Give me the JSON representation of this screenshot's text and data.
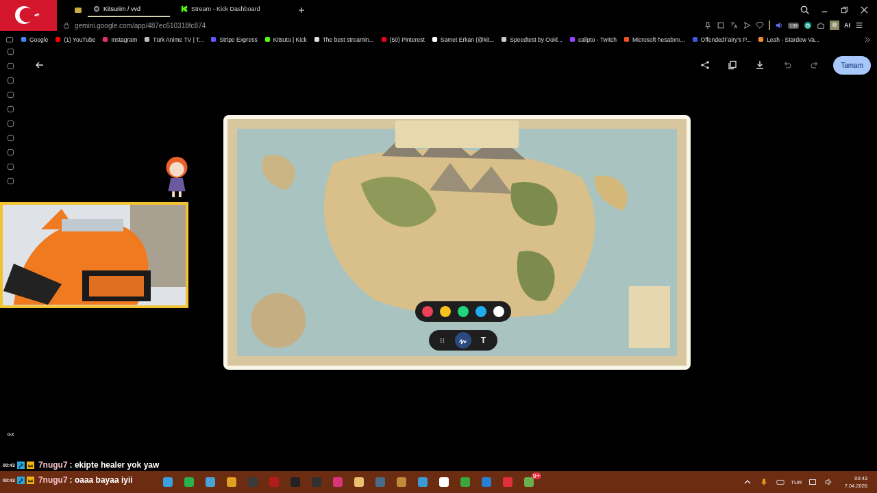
{
  "browser": {
    "tabs": [
      {
        "title": "Kitsurim / vvd",
        "selected": true
      },
      {
        "title": "Stream - Kick Dashboard",
        "selected": false
      }
    ],
    "url": "gemini.google.com/app/487ec610318fc874",
    "bookmarks": [
      "Google",
      "(1) YouTube",
      "Instagram",
      "Türk Anime TV | T...",
      "Stripe Express",
      "Kitsuto | Kick",
      "The best streamin...",
      "(50) Pinterest",
      "Samet Erkan (@kit...",
      "Speedtest by Ookl...",
      "calipto - Twitch",
      "Microsoft hesabını...",
      "OffendedFairy's P...",
      "Leah - Stardew Va..."
    ],
    "extension_badge": "139",
    "ai_label": "AI"
  },
  "sidebar": {
    "label": "GX"
  },
  "editor": {
    "done_button": "Tamam",
    "palette": [
      {
        "color": "#ee4058",
        "selected": false
      },
      {
        "color": "#f7c21a",
        "selected": false
      },
      {
        "color": "#1fd67a",
        "selected": false
      },
      {
        "color": "#1eaef0",
        "selected": false
      },
      {
        "color": "#ffffff",
        "selected": false
      }
    ],
    "tools": [
      {
        "kind": "handle",
        "selected": false
      },
      {
        "kind": "pen",
        "selected": true
      },
      {
        "kind": "text",
        "label": "T",
        "selected": false
      }
    ]
  },
  "chat": [
    {
      "time": "00:43",
      "user": "7nugu7",
      "message": ": ekipte healer yok yaw"
    },
    {
      "time": "00:43",
      "user": "7nugu7",
      "message": ": oaaa bayaa iyii"
    }
  ],
  "taskbar": {
    "discord_badge": "9+",
    "language": "TUR",
    "time": "00:43",
    "date": "7.04.2026"
  }
}
